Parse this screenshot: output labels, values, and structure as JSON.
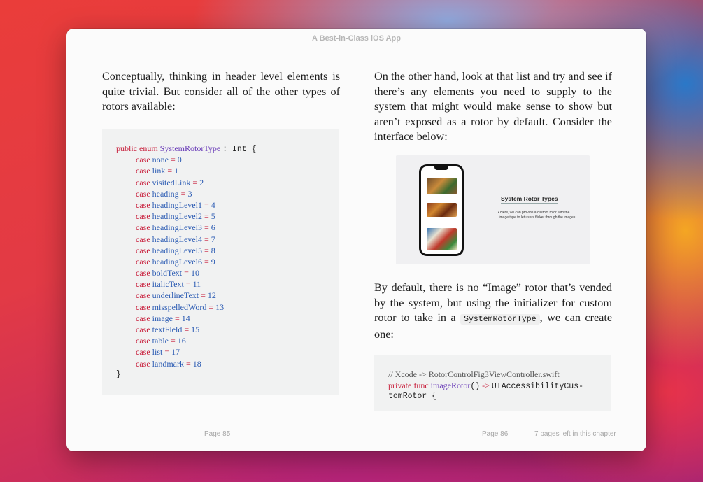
{
  "window": {
    "title": "A Best-in-Class iOS App"
  },
  "left_page": {
    "paragraph": "Conceptually, thinking in header level elements is quite trivial. But consider all of the other types of rotors available:",
    "enum_decl": {
      "kw_public": "public",
      "kw_enum": "enum",
      "type_name": "SystemRotorType",
      "conformance": ": Int {"
    },
    "cases": [
      {
        "name": "none",
        "value": "0"
      },
      {
        "name": "link",
        "value": "1"
      },
      {
        "name": "visitedLink",
        "value": "2"
      },
      {
        "name": "heading",
        "value": "3"
      },
      {
        "name": "headingLevel1",
        "value": "4"
      },
      {
        "name": "headingLevel2",
        "value": "5"
      },
      {
        "name": "headingLevel3",
        "value": "6"
      },
      {
        "name": "headingLevel4",
        "value": "7"
      },
      {
        "name": "headingLevel5",
        "value": "8"
      },
      {
        "name": "headingLevel6",
        "value": "9"
      },
      {
        "name": "boldText",
        "value": "10"
      },
      {
        "name": "italicText",
        "value": "11"
      },
      {
        "name": "underlineText",
        "value": "12"
      },
      {
        "name": "misspelledWord",
        "value": "13"
      },
      {
        "name": "image",
        "value": "14"
      },
      {
        "name": "textField",
        "value": "15"
      },
      {
        "name": "table",
        "value": "16"
      },
      {
        "name": "list",
        "value": "17"
      },
      {
        "name": "landmark",
        "value": "18"
      }
    ],
    "case_kw": "case",
    "eq": "=",
    "closing_brace": "}",
    "page_label": "Page 85"
  },
  "right_page": {
    "paragraph1": "On the other hand, look at that list and try and see if there’s any elements you need to supply to the system that might would make sense to show but aren’t exposed as a rotor by default. Consider the interface below:",
    "figure": {
      "title": "System Rotor Types",
      "bullet": "• Here, we can provide a custom rotor with the .image type to let users flicker through the images."
    },
    "paragraph2_before": "By default, there is no “Image” rotor that’s vended by the system, but using the initializer for custom rotor to take in a ",
    "paragraph2_code": "SystemRotorType",
    "paragraph2_after": ", we can create one:",
    "xcode": {
      "comment": "// Xcode -> RotorControlFig3ViewController.swift",
      "kw_private": "private",
      "kw_func": "func",
      "func_name": "imageRotor",
      "parens": "()",
      "arrow": "->",
      "return_type_part1": "UIAccessibilityCus-",
      "return_type_part2": "tomRotor {"
    },
    "page_label": "Page 86",
    "pages_left": "7 pages left in this chapter"
  },
  "colors": {
    "keyword": "#c81e3b",
    "type": "#6a3cb8",
    "identifier": "#2b5bb3"
  }
}
